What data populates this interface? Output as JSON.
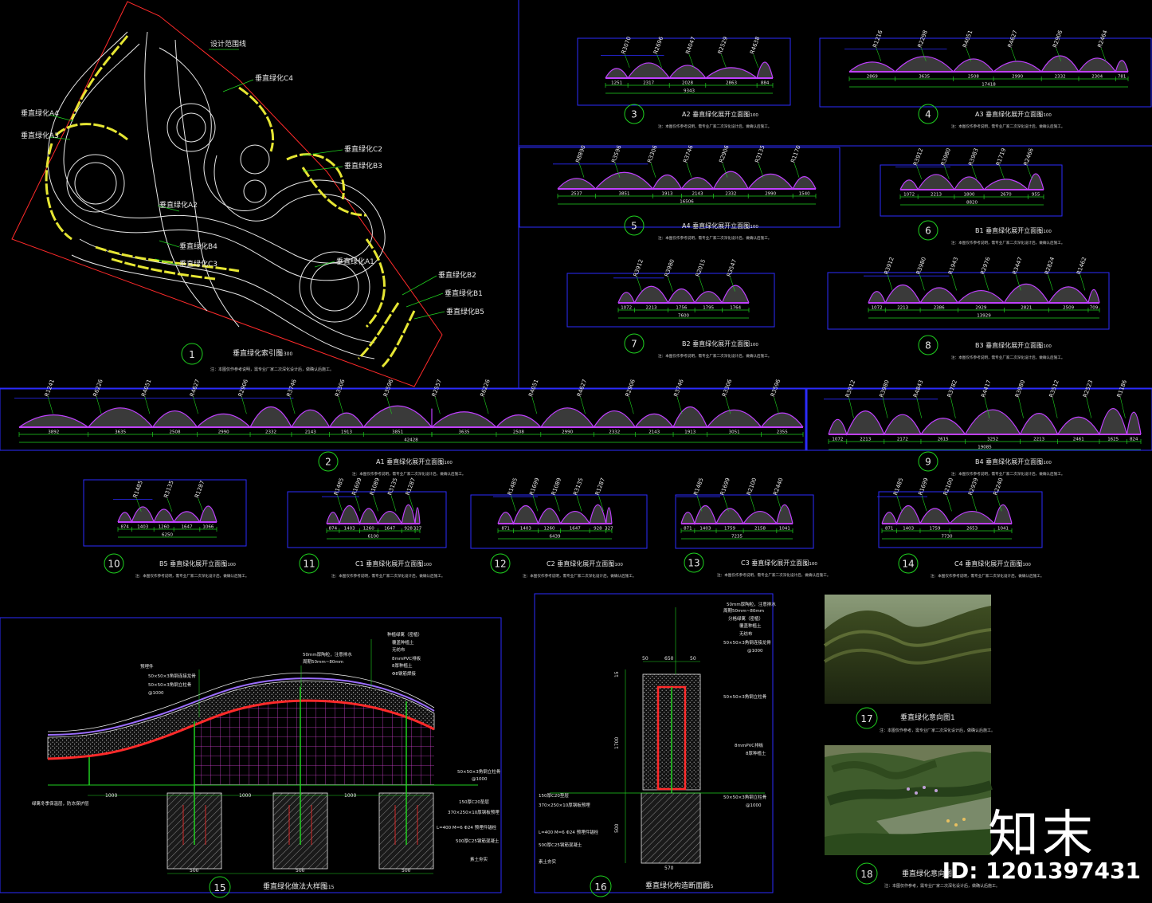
{
  "plan": {
    "number": "1",
    "title": "垂直绿化索引图",
    "scale": "1:300",
    "note": "注：本图仅作参考说明，需专业厂家二次深化设计后，做确认后施工。",
    "labels": {
      "design_line": "设计范围线",
      "c4": "垂直绿化C4",
      "a4": "垂直绿化A4",
      "a3": "垂直绿化A3",
      "c2": "垂直绿化C2",
      "b3": "垂直绿化B3",
      "a2": "垂直绿化A2",
      "b4": "垂直绿化B4",
      "c3": "垂直绿化C3",
      "a1": "垂直绿化A1",
      "b2": "垂直绿化B2",
      "b1": "垂直绿化B1",
      "b5": "垂直绿化B5"
    }
  },
  "elevations": [
    {
      "id": "e3",
      "number": "3",
      "title": "A2 垂直绿化展开立面图",
      "scale": "1:100",
      "dims": [
        "1251",
        "2317",
        "2028",
        "2863",
        "884"
      ],
      "total": "9343",
      "radii": [
        "R3070",
        "R2696",
        "R4047",
        "R2529",
        "R4638"
      ]
    },
    {
      "id": "e4",
      "number": "4",
      "title": "A3 垂直绿化展开立面图",
      "scale": "1:100",
      "dims": [
        "2869",
        "3635",
        "2508",
        "2990",
        "2332",
        "2304",
        "781"
      ],
      "total": "17418",
      "radii": [
        "R1216",
        "R2298",
        "R4051",
        "R4627",
        "R2906",
        "R2464"
      ]
    },
    {
      "id": "e5",
      "number": "5",
      "title": "A4 垂直绿化展开立面图",
      "scale": "1:100",
      "dims": [
        "2537",
        "3851",
        "1913",
        "2143",
        "2332",
        "2990",
        "1540"
      ],
      "total": "16506",
      "radii": [
        "R8890",
        "R3596",
        "R3306",
        "R3746",
        "R2906",
        "R3135",
        "R1170"
      ]
    },
    {
      "id": "e6",
      "number": "6",
      "title": "B1 垂直绿化展开立面图",
      "scale": "1:100",
      "dims": [
        "1072",
        "2213",
        "1800",
        "2670",
        "955"
      ],
      "total": "8820",
      "radii": [
        "R3912",
        "R3980",
        "R3983",
        "R1719",
        "R2466"
      ]
    },
    {
      "id": "e7",
      "number": "7",
      "title": "B2 垂直绿化展开立面图",
      "scale": "1:100",
      "dims": [
        "1072",
        "2213",
        "1756",
        "1795",
        "1764"
      ],
      "total": "7600",
      "radii": [
        "R3912",
        "R3980",
        "R2015",
        "R3547"
      ]
    },
    {
      "id": "e8",
      "number": "8",
      "title": "B3 垂直绿化展开立面图",
      "scale": "1:100",
      "dims": [
        "1072",
        "2213",
        "2386",
        "2929",
        "2821",
        "2509",
        "709"
      ],
      "total": "13929",
      "radii": [
        "R3912",
        "R3980",
        "R1943",
        "R2976",
        "R3447",
        "R2824",
        "R1462"
      ]
    },
    {
      "id": "e2",
      "number": "2",
      "title": "A1 垂直绿化展开立面图",
      "scale": "1:100",
      "dims": [
        "3892",
        "3635",
        "2508",
        "2990",
        "2332",
        "2143",
        "1913",
        "3851",
        "",
        "3635",
        "2508",
        "2990",
        "2332",
        "2143",
        "1913",
        "3051",
        "2355"
      ],
      "total": "42428",
      "radii": [
        "R1241",
        "R6226",
        "R4051",
        "R4627",
        "R2906",
        "R3746",
        "R3306",
        "R3596",
        "R2557",
        "R6226",
        "R4051",
        "R4627",
        "R2906",
        "R3746",
        "R3306",
        "R3596"
      ]
    },
    {
      "id": "e9",
      "number": "9",
      "title": "B4 垂直绿化展开立面图",
      "scale": "1:100",
      "dims": [
        "1072",
        "2213",
        "2172",
        "2615",
        "3252",
        "2213",
        "2461",
        "1625",
        "824"
      ],
      "total": "19085",
      "radii": [
        "R3912",
        "R3980",
        "R4843",
        "R3782",
        "R4417",
        "R3980",
        "R3512",
        "R2523",
        "R1186"
      ]
    },
    {
      "id": "e10",
      "number": "10",
      "title": "B5 垂直绿化展开立面图",
      "scale": "1:100",
      "dims": [
        "874",
        "1403",
        "1260",
        "1647",
        "1066"
      ],
      "total": "6250",
      "radii": [
        "R1485",
        "R3135",
        "R1287"
      ]
    },
    {
      "id": "e11",
      "number": "11",
      "title": "C1 垂直绿化展开立面图",
      "scale": "1:100",
      "dims": [
        "874",
        "1403",
        "1260",
        "1647",
        "928",
        "327"
      ],
      "total": "6100",
      "radii": [
        "R1485",
        "R1699",
        "R1089",
        "R3135",
        "R1287"
      ]
    },
    {
      "id": "e12",
      "number": "12",
      "title": "C2 垂直绿化展开立面图",
      "scale": "1:100",
      "dims": [
        "871",
        "1403",
        "1260",
        "1647",
        "928",
        "327"
      ],
      "total": "6439",
      "radii": [
        "R1485",
        "R1699",
        "R1089",
        "R3135",
        "R1287"
      ]
    },
    {
      "id": "e13",
      "number": "13",
      "title": "C3 垂直绿化展开立面图",
      "scale": "1:100",
      "dims": [
        "871",
        "1403",
        "1759",
        "2158",
        "1041"
      ],
      "total": "7235",
      "radii": [
        "R1485",
        "R1699",
        "R2100",
        "R2440"
      ]
    },
    {
      "id": "e14",
      "number": "14",
      "title": "C4 垂直绿化展开立面图",
      "scale": "1:100",
      "dims": [
        "871",
        "1403",
        "1759",
        "2653",
        "1041"
      ],
      "total": "7730",
      "radii": [
        "R1485",
        "R1699",
        "R2100",
        "R2939",
        "R2240"
      ]
    }
  ],
  "elevation_note": "注：本图仅作参考说明，需专业厂家二次深化设计后，做确认后施工。",
  "detail15": {
    "number": "15",
    "title": "垂直绿化做法大样图",
    "scale": "1:15",
    "callouts_top": [
      "50mm厚陶粒，注意排水",
      "周期50mm~80mm"
    ],
    "callouts_right_top": [
      "种植绿篱（密植）",
      "覆盖种植土",
      "无纺布",
      "8mmPVC排板",
      "8厚种植土",
      "Φ8钢筋焊接"
    ],
    "callouts_left": [
      "预埋件",
      "50×50×3角钢连接龙骨",
      "50×50×3角钢立柱骨",
      "@1000"
    ],
    "callouts_right_bottom": [
      "50×50×3角钢立柱骨",
      "@1000",
      "150厚C20垫层",
      "370×250×10厚钢板预埋",
      "L=400 M=6 Φ24 预埋件锚栓",
      "500厚C25钢筋混凝土",
      "素土夯实"
    ],
    "callout_left_bottom": "绿篱冬季保温层，防冻保护层",
    "dims": [
      "1000",
      "1000",
      "1000",
      "500",
      "500",
      "500"
    ]
  },
  "detail16": {
    "number": "16",
    "title": "垂直绿化构造断面图",
    "scale": "1:15",
    "callouts_right": [
      "50mm厚陶粒，注意排水",
      "周期50mm~80mm",
      "分格绿篱（密植）",
      "覆盖种植土",
      "无纺布",
      "50×50×3角钢连接龙骨",
      "@1000",
      "50×50×3角钢立柱骨",
      "8mmPVC排板",
      "8厚种植土",
      "50×50×3角钢立柱骨",
      "@1000"
    ],
    "callouts_left": [
      "150厚C20垫层",
      "370×250×10厚钢板预埋",
      "L=400 M=6 Φ24 预埋件锚栓",
      "500厚C25钢筋混凝土",
      "素土夯实"
    ],
    "dims": [
      "50",
      "650",
      "50",
      "100",
      "340",
      "15",
      "1700",
      "500",
      "570"
    ]
  },
  "photo17": {
    "number": "17",
    "title": "垂直绿化意向图1",
    "note": "注：本图仅作参考，需专业厂家二次深化设计后，做确认后施工。"
  },
  "photo18": {
    "number": "18",
    "title": "垂直绿化意向图2",
    "note": "注：本图仅作参考，需专业厂家二次深化设计后，做确认后施工。"
  },
  "brand": "知末",
  "id_tag": "ID: 1201397431",
  "colors": {
    "background": "#000000",
    "frame": "#2b2bff",
    "number_circle": "#1fd11f",
    "dimension": "#1fd11f",
    "ground": "#c040ff",
    "red_boundary": "#ff2a2a",
    "yellow_hatch": "#e6e633",
    "white_line": "#e8e8e8",
    "leader": "#ff4fa0"
  }
}
